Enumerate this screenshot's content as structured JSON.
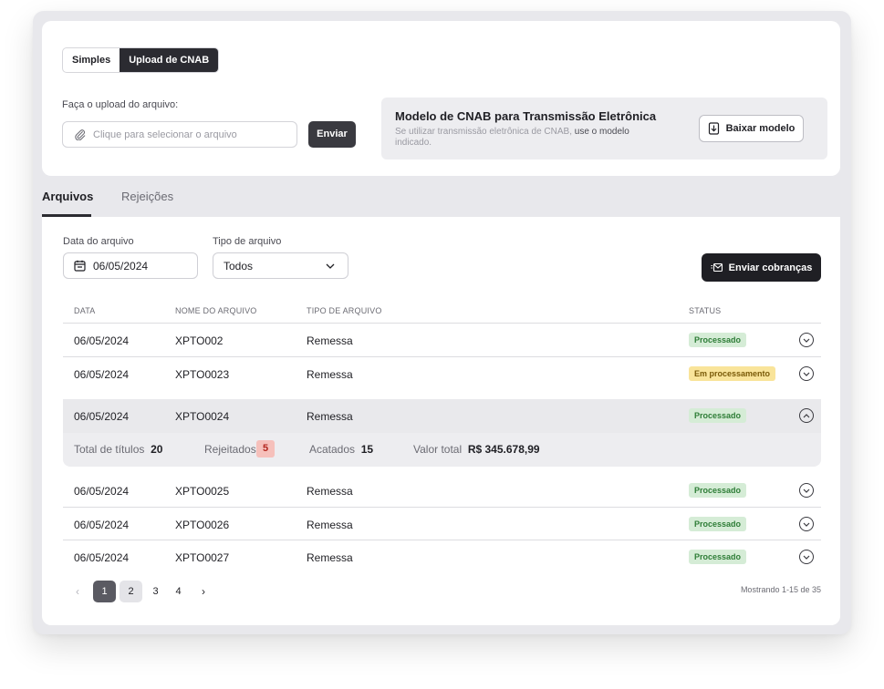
{
  "upload": {
    "mode_tabs": [
      "Simples",
      "Upload de CNAB"
    ],
    "file_label": "Faça o upload do arquivo:",
    "file_placeholder": "Clique para selecionar o arquivo",
    "send_label": "Enviar",
    "model_title": "Modelo de CNAB para Transmissão Eletrônica",
    "model_desc": "Se utilizar transmissão eletrônica de CNAB,",
    "model_desc_strong": "use o modelo",
    "model_desc_end": "indicado.",
    "download_label": "Baixar modelo"
  },
  "tabs": [
    "Arquivos",
    "Rejeições"
  ],
  "filters": {
    "date_label": "Data do arquivo",
    "date_value": "06/05/2024",
    "type_label": "Tipo de arquivo",
    "type_value": "Todos",
    "action_label": "Enviar cobranças"
  },
  "table": {
    "headers": [
      "DATA",
      "NOME DO ARQUIVO",
      "TIPO DE ARQUIVO",
      "STATUS"
    ],
    "rows": [
      {
        "date": "06/05/2024",
        "name": "XPTO002",
        "type": "Remessa",
        "status": "Processado"
      },
      {
        "date": "06/05/2024",
        "name": "XPTO0023",
        "type": "Remessa",
        "status": "Em processamento"
      },
      {
        "date": "06/05/2024",
        "name": "XPTO0024",
        "type": "Remessa",
        "status": "Processado"
      },
      {
        "date": "06/05/2024",
        "name": "XPTO0025",
        "type": "Remessa",
        "status": "Processado"
      },
      {
        "date": "06/05/2024",
        "name": "XPTO0026",
        "type": "Remessa",
        "status": "Processado"
      },
      {
        "date": "06/05/2024",
        "name": "XPTO0027",
        "type": "Remessa",
        "status": "Processado"
      }
    ],
    "detail": {
      "total_label": "Total de títulos",
      "total_value": "20",
      "rejected_label": "Rejeitados",
      "rejected_value": "5",
      "accepted_label": "Acatados",
      "accepted_value": "15",
      "value_label": "Valor total",
      "value_value": "R$ 345.678,99"
    }
  },
  "pagination": {
    "pages": [
      "1",
      "2",
      "3",
      "4"
    ],
    "prev": "‹",
    "next": "›",
    "summary": "Mostrando 1-15 de 35"
  },
  "colors": {
    "primary_dark": "#2b2b31",
    "status_ok": "#d5ecd6",
    "status_processing": "#f9e49a",
    "rejected_badge": "#f6c0bb"
  }
}
